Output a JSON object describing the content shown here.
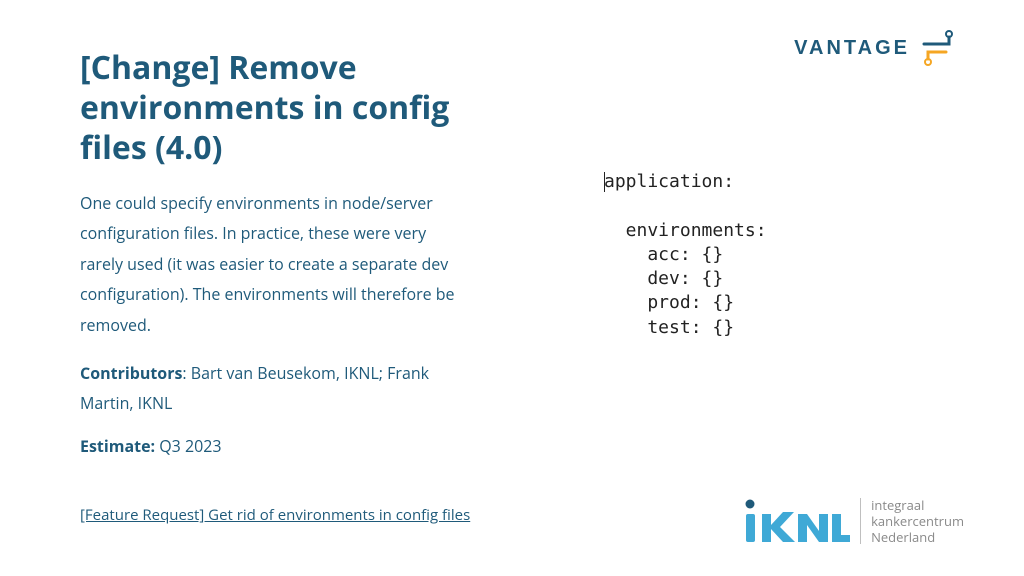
{
  "heading": "[Change] Remove environments in config files (4.0)",
  "description": "One could specify environments in node/server configuration files. In practice, these were very rarely used (it was easier to create a separate dev configuration). The environments will therefore be removed.",
  "contributors": {
    "label": "Contributors",
    "value": ": Bart van Beusekom, IKNL; Frank Martin, IKNL"
  },
  "estimate": {
    "label": "Estimate:",
    "value": " Q3 2023"
  },
  "link": {
    "text": "[Feature Request] Get rid of environments in config files"
  },
  "logos": {
    "vantage": "VANTAGE",
    "iknl_tag1": "integraal",
    "iknl_tag2": "kankercentrum",
    "iknl_tag3": "Nederland"
  },
  "code": {
    "line1": "application:",
    "line2": "  environments:",
    "line3": "    acc: {}",
    "line4": "    dev: {}",
    "line5": "    prod: {}",
    "line6": "    test: {}"
  }
}
